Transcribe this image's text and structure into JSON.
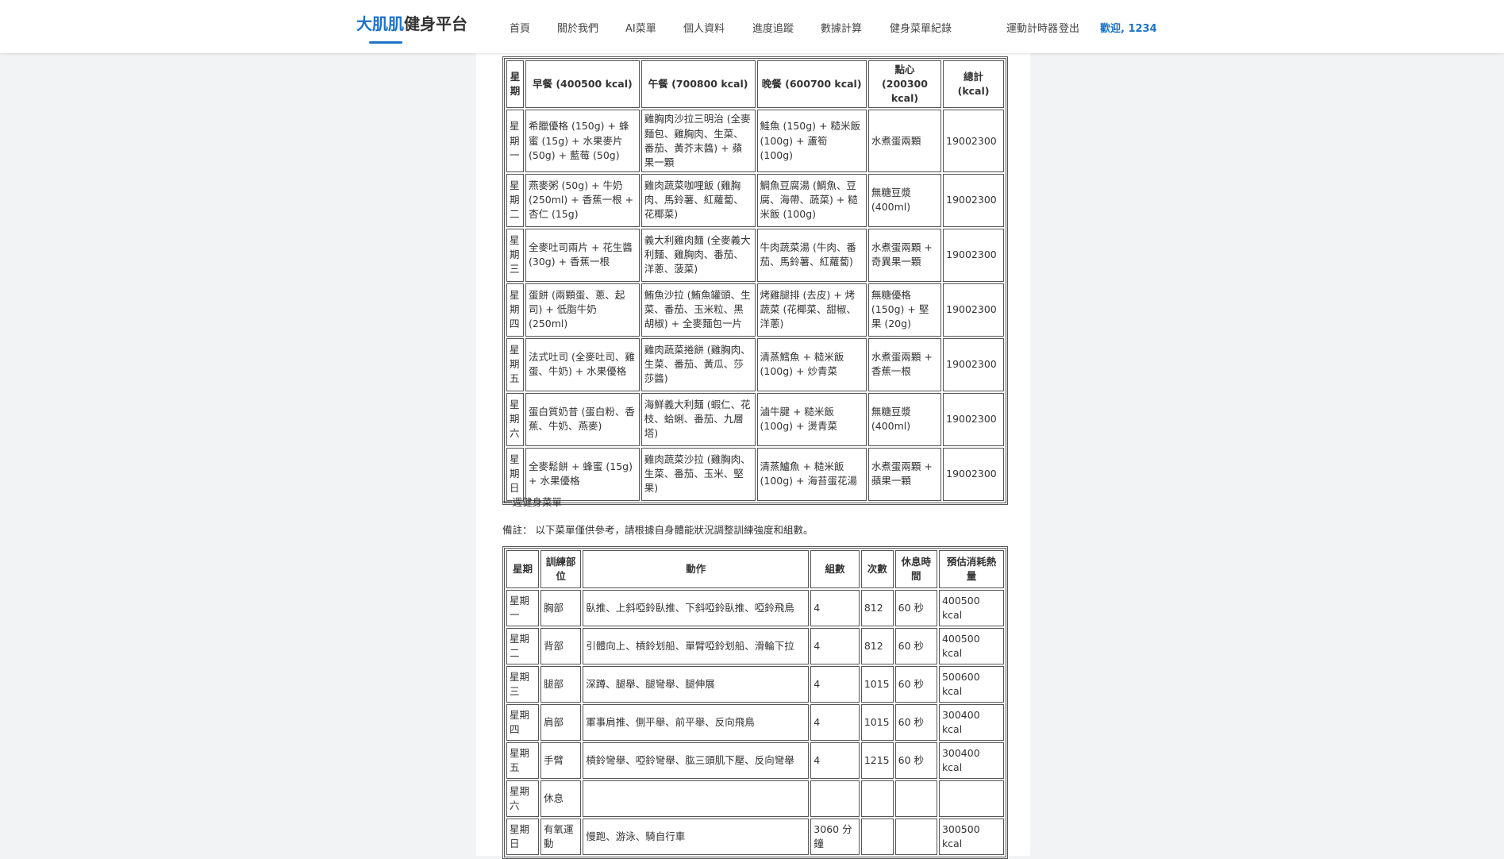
{
  "header": {
    "logo_part1": "大肌肌",
    "logo_part2": "健身平台",
    "nav": [
      "首頁",
      "關於我們",
      "AI菜單",
      "個人資料",
      "進度追蹤",
      "數據計算",
      "健身菜單紀錄",
      "運動計時器",
      "登出"
    ],
    "welcome": "歡迎, 1234",
    "accent_color": "#1a73c9"
  },
  "meal_table": {
    "headers": [
      "星期",
      "早餐 (400500 kcal)",
      "午餐 (700800 kcal)",
      "晚餐 (600700 kcal)",
      "點心 (200300 kcal)",
      "總計 (kcal)"
    ],
    "rows": [
      [
        "星期一",
        "希臘優格 (150g) + 蜂蜜 (15g) + 水果麥片 (50g) + 藍莓 (50g)",
        "雞胸肉沙拉三明治 (全麥麵包、雞胸肉、生菜、番茄、黃芥末醬) + 蘋果一顆",
        "鮭魚 (150g) + 糙米飯 (100g) + 蘆筍 (100g)",
        "水煮蛋兩顆",
        "19002300"
      ],
      [
        "星期二",
        "燕麥粥 (50g) + 牛奶 (250ml) + 香蕉一根 + 杏仁 (15g)",
        "雞肉蔬菜咖哩飯 (雞胸肉、馬鈴薯、紅蘿蔔、花椰菜)",
        "鯛魚豆腐湯 (鯛魚、豆腐、海帶、蔬菜) + 糙米飯 (100g)",
        "無糖豆漿 (400ml)",
        "19002300"
      ],
      [
        "星期三",
        "全麥吐司兩片 + 花生醬 (30g) + 香蕉一根",
        "義大利雞肉麵 (全麥義大利麵、雞胸肉、番茄、洋蔥、菠菜)",
        "牛肉蔬菜湯 (牛肉、番茄、馬鈴薯、紅蘿蔔)",
        "水煮蛋兩顆 + 奇異果一顆",
        "19002300"
      ],
      [
        "星期四",
        "蛋餅 (兩顆蛋、蔥、起司) + 低脂牛奶 (250ml)",
        "鮪魚沙拉 (鮪魚罐頭、生菜、番茄、玉米粒、黑胡椒) + 全麥麵包一片",
        "烤雞腿排 (去皮) + 烤蔬菜 (花椰菜、甜椒、洋蔥)",
        "無糖優格 (150g) + 堅果 (20g)",
        "19002300"
      ],
      [
        "星期五",
        "法式吐司 (全麥吐司、雞蛋、牛奶) + 水果優格",
        "雞肉蔬菜捲餅 (雞胸肉、生菜、番茄、黃瓜、莎莎醬)",
        "清蒸鱈魚 + 糙米飯 (100g) + 炒青菜",
        "水煮蛋兩顆 + 香蕉一根",
        "19002300"
      ],
      [
        "星期六",
        "蛋白質奶昔 (蛋白粉、香蕉、牛奶、燕麥)",
        "海鮮義大利麵 (蝦仁、花枝、蛤蜊、番茄、九層塔)",
        "滷牛腱 + 糙米飯 (100g) + 燙青菜",
        "無糖豆漿 (400ml)",
        "19002300"
      ],
      [
        "星期日",
        "全麥鬆餅 + 蜂蜜 (15g) + 水果優格",
        "雞肉蔬菜沙拉 (雞胸肉、生菜、番茄、玉米、堅果)",
        "清蒸鱸魚 + 糙米飯 (100g) + 海苔蛋花湯",
        "水煮蛋兩顆 + 蘋果一顆",
        "19002300"
      ]
    ]
  },
  "section_title": "一週健身菜單",
  "note": "備註： 以下菜單僅供參考，請根據自身體能狀況調整訓練強度和組數。",
  "workout_table": {
    "headers": [
      "星期",
      "訓練部位",
      "動作",
      "組數",
      "次數",
      "休息時間",
      "預估消耗熱量"
    ],
    "rows": [
      [
        "星期一",
        "胸部",
        "臥推、上斜啞鈴臥推、下斜啞鈴臥推、啞鈴飛鳥",
        "4",
        "812",
        "60 秒",
        "400500 kcal"
      ],
      [
        "星期二",
        "背部",
        "引體向上、槓鈴划船、單臂啞鈴划船、滑輪下拉",
        "4",
        "812",
        "60 秒",
        "400500 kcal"
      ],
      [
        "星期三",
        "腿部",
        "深蹲、腿舉、腿彎舉、腿伸展",
        "4",
        "1015",
        "60 秒",
        "500600 kcal"
      ],
      [
        "星期四",
        "肩部",
        "軍事肩推、側平舉、前平舉、反向飛鳥",
        "4",
        "1015",
        "60 秒",
        "300400 kcal"
      ],
      [
        "星期五",
        "手臂",
        "槓鈴彎舉、啞鈴彎舉、肱三頭肌下壓、反向彎舉",
        "4",
        "1215",
        "60 秒",
        "300400 kcal"
      ],
      [
        "星期六",
        "休息",
        "",
        "",
        "",
        "",
        ""
      ],
      [
        "星期日",
        "有氧運動",
        "慢跑、游泳、騎自行車",
        "3060 分鐘",
        "",
        "",
        "300500 kcal"
      ]
    ]
  }
}
